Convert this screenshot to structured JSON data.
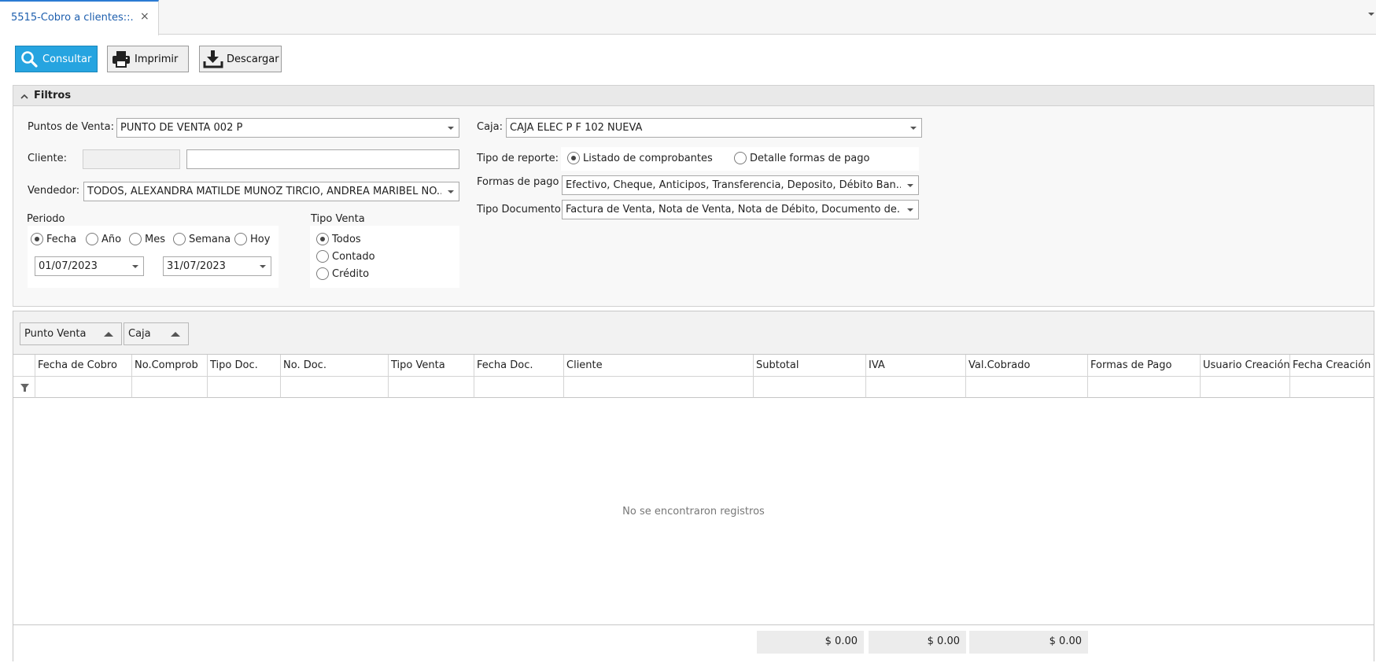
{
  "tabs": [
    {
      "label": "5515-Cobro a clientes::.",
      "close": "×"
    }
  ],
  "toolbar": {
    "consultar_label": "Consultar",
    "imprimir_label": "Imprimir",
    "descargar_label": "Descargar"
  },
  "filtros": {
    "title": "Filtros",
    "puntos_venta_label": "Puntos de Venta:",
    "puntos_venta_value": "PUNTO DE VENTA 002 P",
    "cliente_label": "Cliente:",
    "cliente_code": "",
    "cliente_name": "",
    "vendedor_label": "Vendedor:",
    "vendedor_value": "TODOS, ALEXANDRA MATILDE MUÑOZ TIRCIO, ANDREA MARIBEL NO...",
    "periodo_label": "Periodo",
    "periodo_options": [
      "Fecha",
      "Año",
      "Mes",
      "Semana",
      "Hoy"
    ],
    "periodo_selected": "Fecha",
    "fecha_desde": "01/07/2023",
    "fecha_hasta": "31/07/2023",
    "tipo_venta_label": "Tipo Venta",
    "tipo_venta_options": [
      "Todos",
      "Contado",
      "Crédito"
    ],
    "tipo_venta_selected": "Todos",
    "caja_label": "Caja:",
    "caja_value": "CAJA ELEC P F 102 NUEVA",
    "tipo_reporte_label": "Tipo de reporte:",
    "tipo_reporte_options": [
      "Listado de comprobantes",
      "Detalle formas de pago"
    ],
    "tipo_reporte_selected": "Listado de comprobantes",
    "formas_pago_label": "Formas de pago",
    "formas_pago_value": "Efectivo, Cheque, Anticipos, Transferencia, Deposito, Débito Ban...",
    "tipo_documento_label": "Tipo Documento",
    "tipo_documento_value": "Factura de Venta, Nota de Venta, Nota de Débito, Documento de..."
  },
  "grid": {
    "group_by": [
      "Punto Venta",
      "Caja"
    ],
    "columns": [
      "Fecha de Cobro",
      "No.Comprob",
      "Tipo Doc.",
      "No. Doc.",
      "Tipo Venta",
      "Fecha Doc.",
      "Cliente",
      "Subtotal",
      "IVA",
      "Val.Cobrado",
      "Formas de Pago",
      "Usuario Creación",
      "Fecha Creación"
    ],
    "empty_message": "No se encontraron registros",
    "totals": {
      "subtotal": "$ 0.00",
      "iva": "$ 0.00",
      "val_cobrado": "$ 0.00"
    }
  },
  "icons": {
    "consultar": "search-icon",
    "imprimir": "printer-icon",
    "descargar": "download-icon",
    "filtros": "chevron-up-icon",
    "filter_row": "filter-icon"
  },
  "colors": {
    "accent": "#26a4e0",
    "tab_accent": "#2b7bd3"
  }
}
